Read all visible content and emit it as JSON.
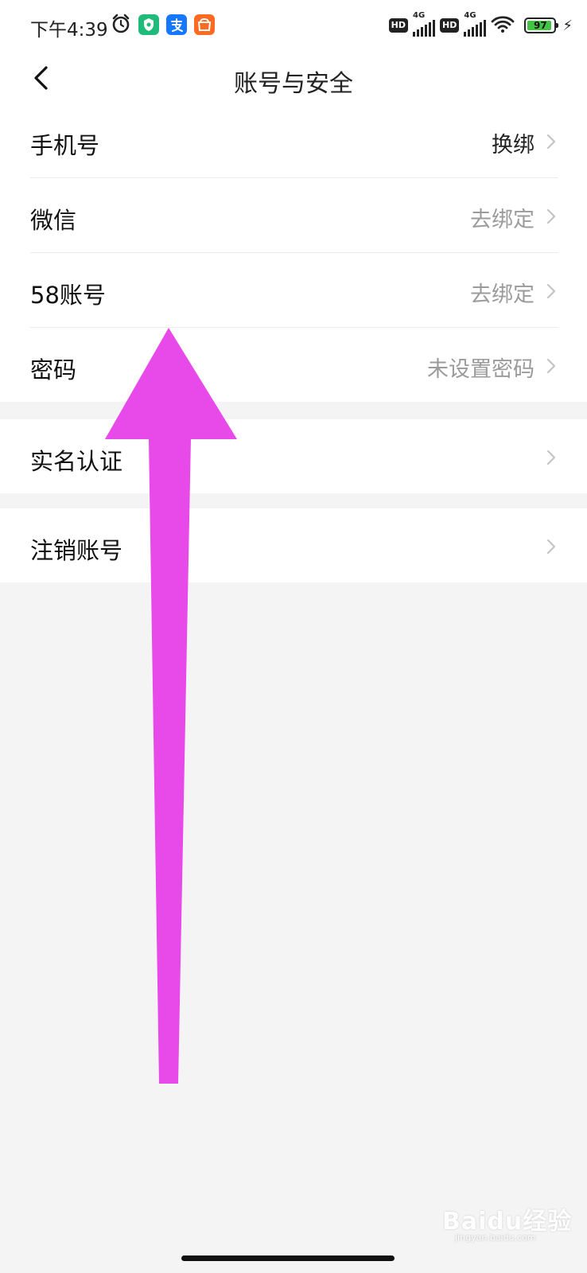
{
  "status_bar": {
    "time": "下午4:39",
    "app_icons": [
      "shield-app-icon",
      "alipay-app-icon",
      "taobao-app-icon"
    ],
    "hd_badge": "HD",
    "network_label": "4G",
    "battery_level": "97"
  },
  "header": {
    "title": "账号与安全"
  },
  "sections": [
    {
      "rows": [
        {
          "label": "手机号",
          "value": "换绑"
        },
        {
          "label": "微信",
          "value": "去绑定"
        },
        {
          "label": "58账号",
          "value": "去绑定"
        },
        {
          "label": "密码",
          "value": "未设置密码"
        }
      ]
    },
    {
      "rows": [
        {
          "label": "实名认证",
          "value": ""
        }
      ]
    },
    {
      "rows": [
        {
          "label": "注销账号",
          "value": ""
        }
      ]
    }
  ],
  "annotation": {
    "arrow_color": "#e84aea",
    "direction": "up"
  },
  "watermark": {
    "brand": "Baidu经验",
    "url": "jingyan.baidu.com"
  }
}
